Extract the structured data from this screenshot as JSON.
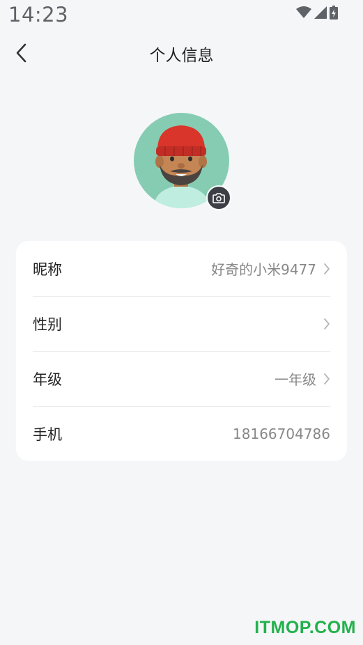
{
  "status_bar": {
    "time": "14:23",
    "icons": [
      "wifi-icon",
      "signal-icon",
      "battery-icon"
    ]
  },
  "nav": {
    "title": "个人信息",
    "back_icon": "chevron-left-icon"
  },
  "profile": {
    "avatar": "avatar-illustration",
    "camera_icon": "camera-icon"
  },
  "info_rows": [
    {
      "label": "昵称",
      "value": "好奇的小米9477",
      "chevron": true
    },
    {
      "label": "性别",
      "value": "",
      "chevron": true
    },
    {
      "label": "年级",
      "value": "一年级",
      "chevron": true
    },
    {
      "label": "手机",
      "value": "18166704786",
      "chevron": false
    }
  ],
  "watermark": "ITMOP.COM",
  "colors": {
    "background": "#f5f6f8",
    "card": "#ffffff",
    "avatar_bg": "#86ccb2",
    "watermark": "#22b14c"
  }
}
